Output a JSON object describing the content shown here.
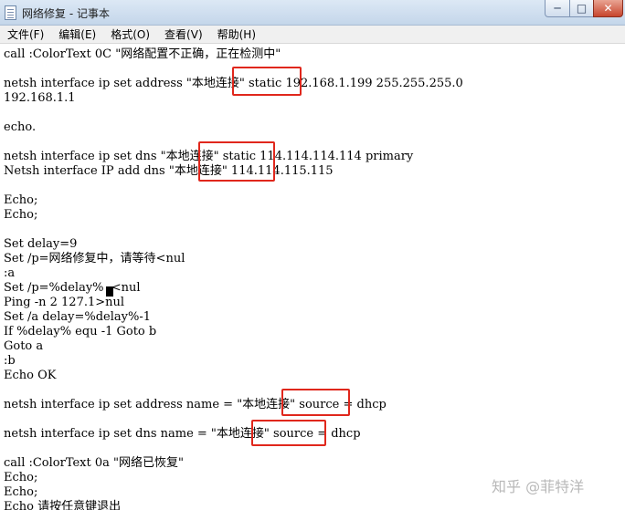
{
  "window": {
    "title": "网络修复 - 记事本",
    "buttons": {
      "minimize": "─",
      "maximize": "□",
      "close": "✕"
    }
  },
  "menu": [
    "文件(F)",
    "编辑(E)",
    "格式(O)",
    "查看(V)",
    "帮助(H)"
  ],
  "lines": [
    "call :ColorText 0C \"网络配置不正确，正在检测中\"",
    "",
    "netsh interface ip set address \"本地连接\" static 192.168.1.199 255.255.255.0",
    "192.168.1.1",
    "",
    "echo.",
    "",
    "netsh interface ip set dns \"本地连接\" static 114.114.114.114 primary",
    "Netsh interface IP add dns \"本地连接\" 114.114.115.115",
    "",
    "Echo;",
    "Echo;",
    "",
    "Set delay=9",
    "Set /p=网络修复中，请等待<nul",
    ":a",
    "Set /p=%delay%  <nul",
    "Ping -n 2 127.1>nul",
    "Set /a delay=%delay%-1",
    "If %delay% equ -1 Goto b",
    "Goto a",
    ":b",
    "Echo OK",
    "",
    "netsh interface ip set address name = \"本地连接\" source = dhcp",
    "",
    "netsh interface ip set dns name = \"本地连接\" source = dhcp",
    "",
    "call :ColorText 0a \"网络已恢复\"",
    "Echo;",
    "Echo;",
    "Echo 请按任意键退出"
  ],
  "watermark": "知乎 @菲特洋",
  "colors": {
    "highlight": "#e0271c",
    "watermark": "#b8b8b8"
  }
}
